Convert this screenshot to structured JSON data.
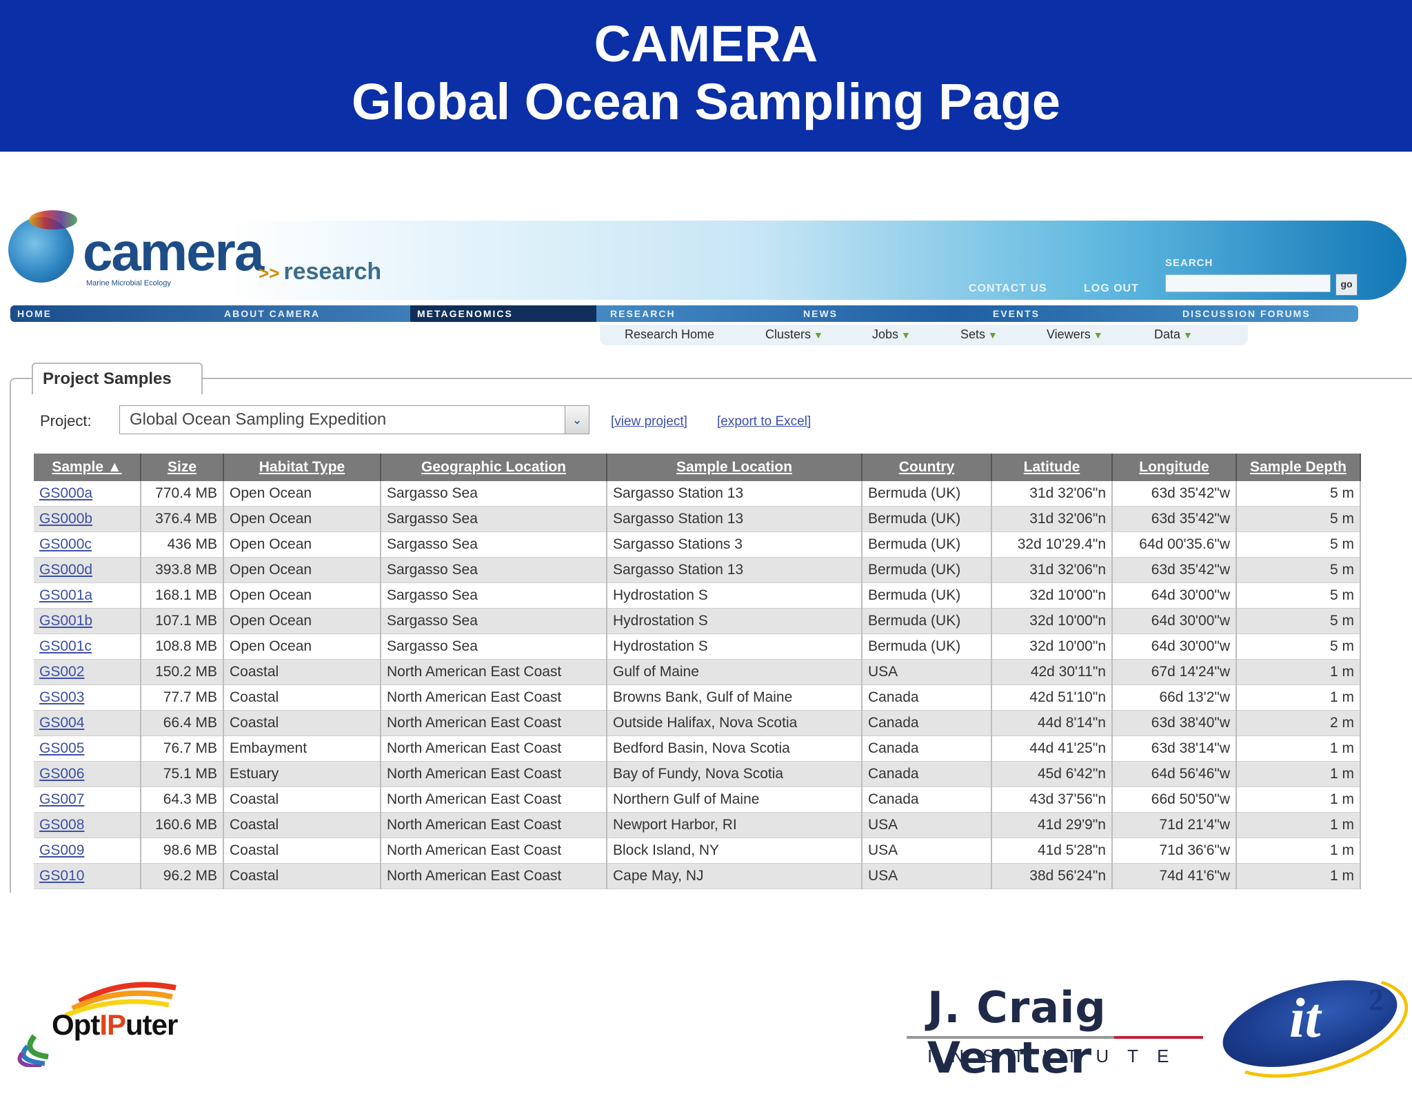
{
  "slide": {
    "title_line1": "CAMERA",
    "title_line2": "Global Ocean Sampling Page"
  },
  "site": {
    "logo": "camera",
    "logo_subtitle": "Marine Microbial Ecology",
    "section": "research",
    "contact_link": "CONTACT US",
    "logout_link": "LOG OUT",
    "search_label": "SEARCH",
    "search_value": "",
    "search_button": "go",
    "nav": [
      "HOME",
      "ABOUT CAMERA",
      "METAGENOMICS",
      "RESEARCH",
      "NEWS",
      "EVENTS",
      "DISCUSSION FORUMS"
    ],
    "nav_active": "METAGENOMICS",
    "subnav": [
      {
        "label": "Research Home",
        "dropdown": false
      },
      {
        "label": "Clusters",
        "dropdown": true
      },
      {
        "label": "Jobs",
        "dropdown": true
      },
      {
        "label": "Sets",
        "dropdown": true
      },
      {
        "label": "Viewers",
        "dropdown": true
      },
      {
        "label": "Data",
        "dropdown": true
      }
    ]
  },
  "panel": {
    "tab_label": "Project Samples",
    "project_label": "Project:",
    "project_selected": "Global Ocean Sampling Expedition",
    "view_project_link": "[view project]",
    "export_link": "[export to Excel]"
  },
  "table": {
    "headers": [
      "Sample ▲",
      "Size",
      "Habitat Type",
      "Geographic Location",
      "Sample Location",
      "Country",
      "Latitude",
      "Longitude",
      "Sample Depth"
    ],
    "rows": [
      [
        "GS000a",
        "770.4 MB",
        "Open Ocean",
        "Sargasso Sea",
        "Sargasso Station 13",
        "Bermuda (UK)",
        "31d 32'06\"n",
        "63d 35'42\"w",
        "5 m"
      ],
      [
        "GS000b",
        "376.4 MB",
        "Open Ocean",
        "Sargasso Sea",
        "Sargasso Station 13",
        "Bermuda (UK)",
        "31d 32'06\"n",
        "63d 35'42\"w",
        "5 m"
      ],
      [
        "GS000c",
        "436 MB",
        "Open Ocean",
        "Sargasso Sea",
        "Sargasso Stations 3",
        "Bermuda (UK)",
        "32d 10'29.4\"n",
        "64d 00'35.6\"w",
        "5 m"
      ],
      [
        "GS000d",
        "393.8 MB",
        "Open Ocean",
        "Sargasso Sea",
        "Sargasso Station 13",
        "Bermuda (UK)",
        "31d 32'06\"n",
        "63d 35'42\"w",
        "5 m"
      ],
      [
        "GS001a",
        "168.1 MB",
        "Open Ocean",
        "Sargasso Sea",
        "Hydrostation S",
        "Bermuda (UK)",
        "32d 10'00\"n",
        "64d 30'00\"w",
        "5 m"
      ],
      [
        "GS001b",
        "107.1 MB",
        "Open Ocean",
        "Sargasso Sea",
        "Hydrostation S",
        "Bermuda (UK)",
        "32d 10'00\"n",
        "64d 30'00\"w",
        "5 m"
      ],
      [
        "GS001c",
        "108.8 MB",
        "Open Ocean",
        "Sargasso Sea",
        "Hydrostation S",
        "Bermuda (UK)",
        "32d 10'00\"n",
        "64d 30'00\"w",
        "5 m"
      ],
      [
        "GS002",
        "150.2 MB",
        "Coastal",
        "North American East Coast",
        "Gulf of Maine",
        "USA",
        "42d 30'11\"n",
        "67d 14'24\"w",
        "1 m"
      ],
      [
        "GS003",
        "77.7 MB",
        "Coastal",
        "North American East Coast",
        "Browns Bank, Gulf of Maine",
        "Canada",
        "42d 51'10\"n",
        "66d 13'2\"w",
        "1 m"
      ],
      [
        "GS004",
        "66.4 MB",
        "Coastal",
        "North American East Coast",
        "Outside Halifax, Nova Scotia",
        "Canada",
        "44d 8'14\"n",
        "63d 38'40\"w",
        "2 m"
      ],
      [
        "GS005",
        "76.7 MB",
        "Embayment",
        "North American East Coast",
        "Bedford Basin, Nova Scotia",
        "Canada",
        "44d 41'25\"n",
        "63d 38'14\"w",
        "1 m"
      ],
      [
        "GS006",
        "75.1 MB",
        "Estuary",
        "North American East Coast",
        "Bay of Fundy, Nova Scotia",
        "Canada",
        "45d 6'42\"n",
        "64d 56'46\"w",
        "1 m"
      ],
      [
        "GS007",
        "64.3 MB",
        "Coastal",
        "North American East Coast",
        "Northern Gulf of Maine",
        "Canada",
        "43d 37'56\"n",
        "66d 50'50\"w",
        "1 m"
      ],
      [
        "GS008",
        "160.6 MB",
        "Coastal",
        "North American East Coast",
        "Newport Harbor, RI",
        "USA",
        "41d 29'9\"n",
        "71d 21'4\"w",
        "1 m"
      ],
      [
        "GS009",
        "98.6 MB",
        "Coastal",
        "North American East Coast",
        "Block Island, NY",
        "USA",
        "41d 5'28\"n",
        "71d 36'6\"w",
        "1 m"
      ],
      [
        "GS010",
        "96.2 MB",
        "Coastal",
        "North American East Coast",
        "Cape May, NJ",
        "USA",
        "38d 56'24\"n",
        "74d 41'6\"w",
        "1 m"
      ]
    ]
  },
  "footer": {
    "optiputer_pre": "Opt",
    "optiputer_ip": "IP",
    "optiputer_post": "uter",
    "jcvi_name": "J. Craig Venter",
    "jcvi_institute": "INSTITUTE",
    "it2_text": "it",
    "it2_sup": "2"
  }
}
